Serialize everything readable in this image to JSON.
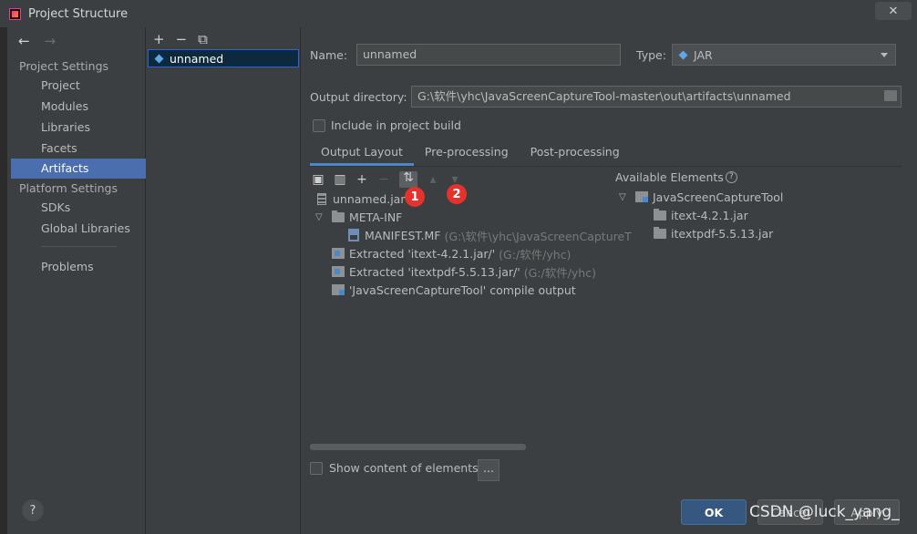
{
  "window": {
    "title": "Project Structure",
    "close_label": "✕"
  },
  "nav": {
    "back_icon": "arrow-left-icon",
    "forward_icon": "arrow-right-icon",
    "back": "←",
    "forward": "→"
  },
  "sidebar": {
    "project_settings": "Project Settings",
    "items_project": [
      "Project",
      "Modules",
      "Libraries",
      "Facets",
      "Artifacts"
    ],
    "platform_settings": "Platform Settings",
    "items_platform": [
      "SDKs",
      "Global Libraries"
    ],
    "problems": "Problems",
    "selected": "Artifacts"
  },
  "artifacts_list": {
    "toolbar": {
      "add": "+",
      "remove": "−",
      "copy": "⧉"
    },
    "items": [
      "unnamed"
    ]
  },
  "form": {
    "name_label": "Name:",
    "name_value": "unnamed",
    "type_label": "Type:",
    "type_value": "JAR",
    "output_dir_label": "Output directory:",
    "output_dir_value": "G:\\软件\\yhc\\JavaScreenCaptureTool-master\\out\\artifacts\\unnamed",
    "include_build_label": "Include in project build",
    "include_build_checked": false
  },
  "tabs": [
    "Output Layout",
    "Pre-processing",
    "Post-processing"
  ],
  "active_tab": "Output Layout",
  "markers": [
    "1",
    "2"
  ],
  "output_tree": {
    "root": "unnamed.jar",
    "meta_inf": "META-INF",
    "manifest": "MANIFEST.MF",
    "manifest_path": "(G:\\软件\\yhc\\JavaScreenCaptureT",
    "extracted1": "Extracted 'itext-4.2.1.jar/'",
    "extracted1_path": "(G:/软件/yhc)",
    "extracted2": "Extracted 'itextpdf-5.5.13.jar/'",
    "extracted2_path": "(G:/软件/yhc)",
    "compile_output": "'JavaScreenCaptureTool' compile output"
  },
  "available": {
    "title": "Available Elements",
    "help": "?",
    "module": "JavaScreenCaptureTool",
    "children": [
      "itext-4.2.1.jar",
      "itextpdf-5.5.13.jar"
    ]
  },
  "show_content_label": "Show content of elements",
  "dots_label": "...",
  "buttons": {
    "ok": "OK",
    "cancel": "Cancel",
    "apply": "Apply"
  },
  "help_button": "?",
  "watermark": "CSDN @luck_yang_",
  "colors": {
    "selection": "#4b6eaf",
    "marker": "#e5322d",
    "ok_button": "#365880"
  }
}
